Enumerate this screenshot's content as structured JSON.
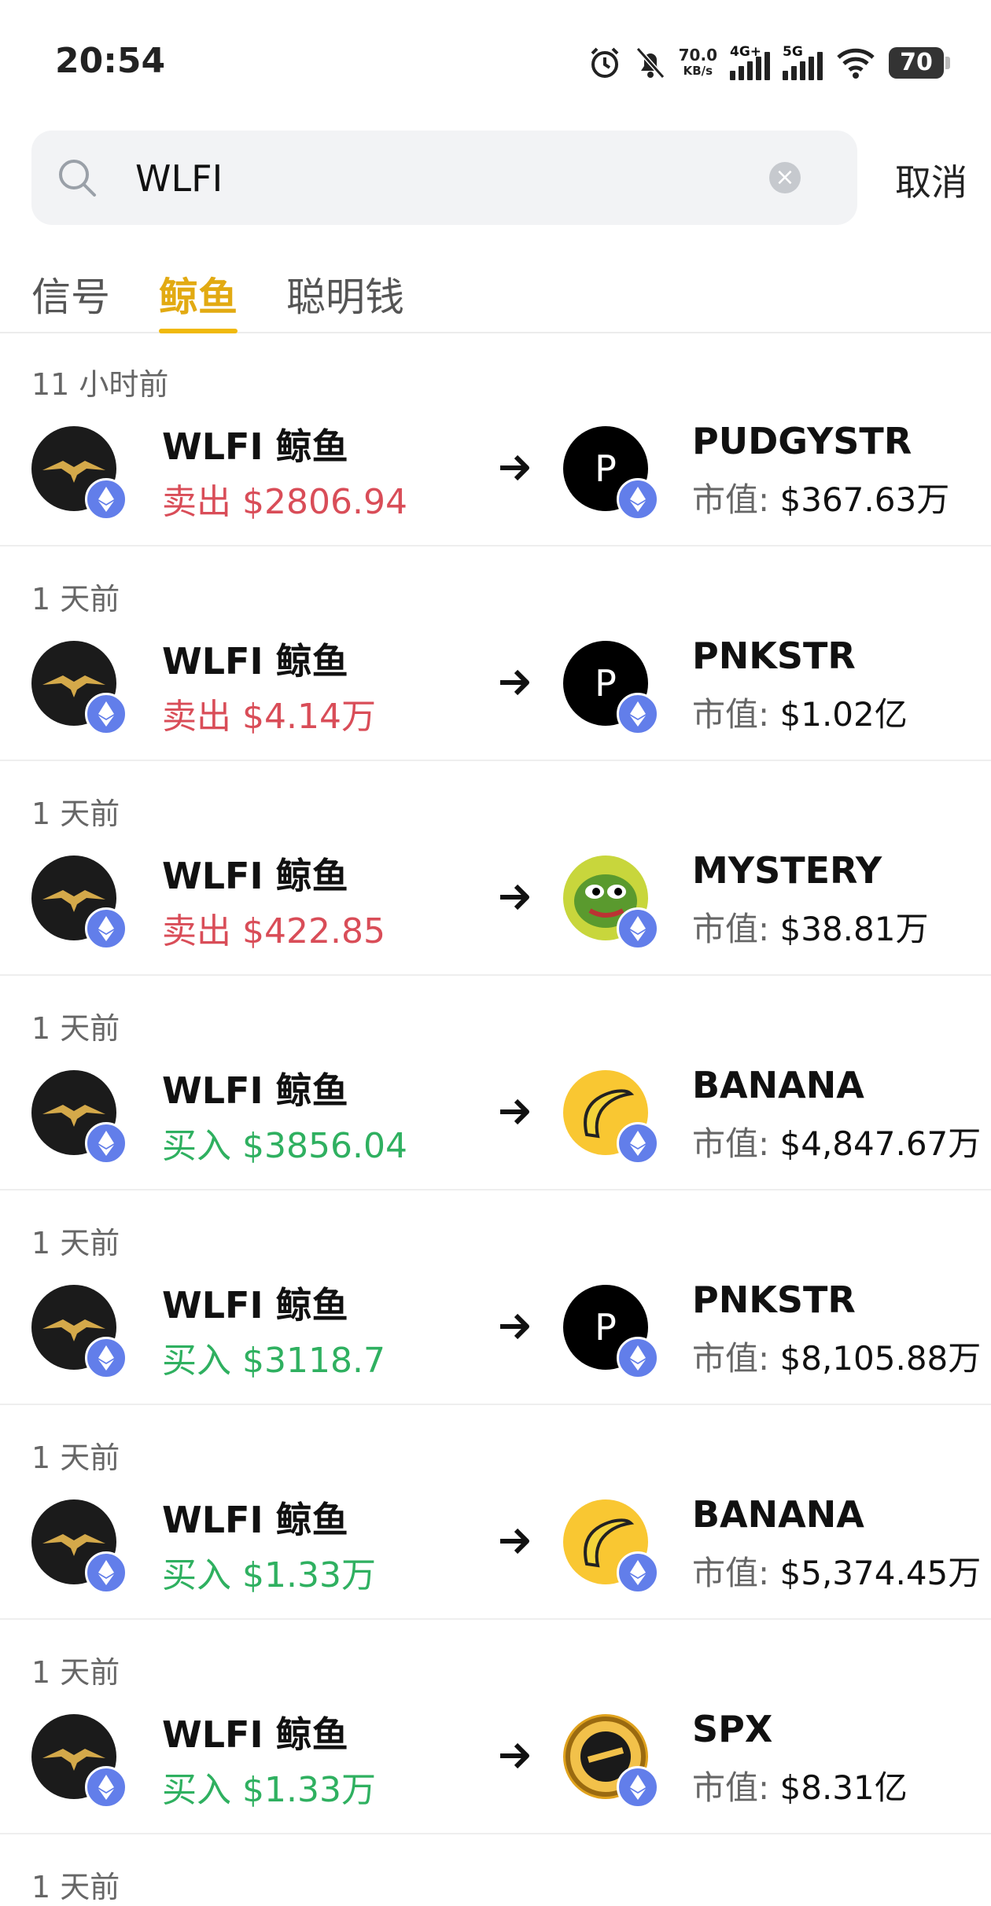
{
  "status_bar": {
    "time": "20:54",
    "net_speed": "70.0",
    "net_unit": "KB/s",
    "sig1": "4G+",
    "sig2": "5G",
    "battery": "70"
  },
  "search": {
    "value": "WLFI",
    "placeholder": "",
    "cancel_label": "取消"
  },
  "tabs": [
    {
      "label": "信号"
    },
    {
      "label": "鲸鱼"
    },
    {
      "label": "聪明钱"
    }
  ],
  "active_tab": "鲸鱼",
  "mcap_label": "市值:",
  "items": [
    {
      "ago": "11 小时前",
      "whale": "WLFI 鲸鱼",
      "action": "卖出",
      "amount": "$2806.94",
      "token": "PUDGYSTR",
      "mcap": "$367.63万",
      "icon": "P"
    },
    {
      "ago": "1 天前",
      "whale": "WLFI 鲸鱼",
      "action": "卖出",
      "amount": "$4.14万",
      "token": "PNKSTR",
      "mcap": "$1.02亿",
      "icon": "P"
    },
    {
      "ago": "1 天前",
      "whale": "WLFI 鲸鱼",
      "action": "卖出",
      "amount": "$422.85",
      "token": "MYSTERY",
      "mcap": "$38.81万",
      "icon": ""
    },
    {
      "ago": "1 天前",
      "whale": "WLFI 鲸鱼",
      "action": "买入",
      "amount": "$3856.04",
      "token": "BANANA",
      "mcap": "$4,847.67万",
      "icon": ""
    },
    {
      "ago": "1 天前",
      "whale": "WLFI 鲸鱼",
      "action": "买入",
      "amount": "$3118.7",
      "token": "PNKSTR",
      "mcap": "$8,105.88万",
      "icon": "P"
    },
    {
      "ago": "1 天前",
      "whale": "WLFI 鲸鱼",
      "action": "买入",
      "amount": "$1.33万",
      "token": "BANANA",
      "mcap": "$5,374.45万",
      "icon": ""
    },
    {
      "ago": "1 天前",
      "whale": "WLFI 鲸鱼",
      "action": "买入",
      "amount": "$1.33万",
      "token": "SPX",
      "mcap": "$8.31亿",
      "icon": ""
    }
  ],
  "partial_item": {
    "ago": "1 天前"
  },
  "colors": {
    "accent": "#f0b90b",
    "sell": "#d94d58",
    "buy": "#2fb060",
    "chain": "#627eea"
  }
}
